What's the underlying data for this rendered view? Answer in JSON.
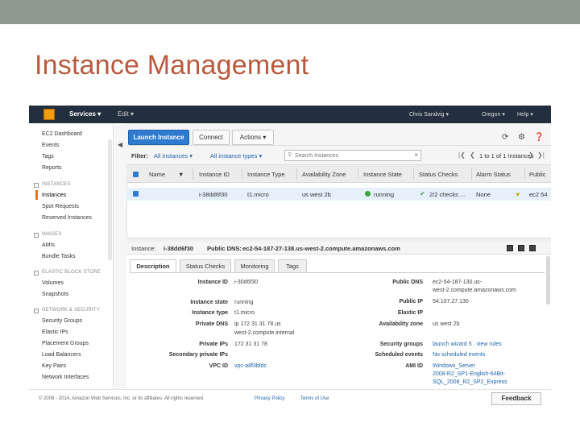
{
  "slide": {
    "title": "Instance Management"
  },
  "header": {
    "services_label": "Services",
    "edit_label": "Edit",
    "user": "Chris Sandvig",
    "region": "Oregon",
    "help": "Help"
  },
  "sidebar": {
    "items": [
      {
        "label": "EC2 Dashboard"
      },
      {
        "label": "Events"
      },
      {
        "label": "Tags"
      },
      {
        "label": "Reports"
      }
    ],
    "instances_head": "INSTANCES",
    "instances_items": [
      {
        "label": "Instances"
      },
      {
        "label": "Spot Requests"
      },
      {
        "label": "Reserved Instances"
      }
    ],
    "images_head": "IMAGES",
    "images_items": [
      {
        "label": "AMIs"
      },
      {
        "label": "Bundle Tasks"
      }
    ],
    "ebs_head": "ELASTIC BLOCK STORE",
    "ebs_items": [
      {
        "label": "Volumes"
      },
      {
        "label": "Snapshots"
      }
    ],
    "net_head": "NETWORK & SECURITY",
    "net_items": [
      {
        "label": "Security Groups"
      },
      {
        "label": "Elastic IPs"
      },
      {
        "label": "Placement Groups"
      },
      {
        "label": "Load Balancers"
      },
      {
        "label": "Key Pairs"
      },
      {
        "label": "Network Interfaces"
      }
    ]
  },
  "toolbar": {
    "launch": "Launch Instance",
    "connect": "Connect",
    "actions": "Actions"
  },
  "filter": {
    "label": "Filter:",
    "instances": "All instances",
    "types": "All instance types",
    "search_placeholder": "Search Instances",
    "paging": "1 to 1 of 1 Instances"
  },
  "table": {
    "columns": [
      "Name",
      "Instance ID",
      "Instance Type",
      "Availability Zone",
      "Instance State",
      "Status Checks",
      "Alarm Status",
      "Public"
    ],
    "rows": [
      {
        "name": "",
        "instance_id": "i-38dd6f30",
        "type": "t1.micro",
        "zone": "us west 2b",
        "state": "running",
        "checks": "2/2 checks ...",
        "alarm": "None",
        "public": "ec2 54"
      }
    ]
  },
  "detail": {
    "instance_label": "Instance:",
    "instance_id": "i-38dd6f30",
    "dns_label": "Public DNS:",
    "dns": "ec2-54-187-27-138.us-west-2.compute.amazonaws.com",
    "tabs": [
      "Description",
      "Status Checks",
      "Monitoring",
      "Tags"
    ],
    "left": [
      {
        "label": "Instance ID",
        "value": "i-30d6f30"
      },
      {
        "label": "Instance state",
        "value": "running"
      },
      {
        "label": "Instance type",
        "value": "t1.micro"
      },
      {
        "label": "Private DNS",
        "value": "ip 172 31 31 78.us",
        "value2": "west-2.compute.internal"
      },
      {
        "label": "Private IPs",
        "value": "172 31 31 78"
      },
      {
        "label": "Secondary private IPs",
        "value": ""
      },
      {
        "label": "VPC ID",
        "value": "vpc-a8f3bfdc"
      }
    ],
    "right": [
      {
        "label": "Public DNS",
        "value": "ec2-54-187-130.us-",
        "value2": "west-2.compute.amazonaws.com"
      },
      {
        "label": "Public IP",
        "value": "54.107.27.130"
      },
      {
        "label": "Elastic IP",
        "value": ""
      },
      {
        "label": "Availability zone",
        "value": "us west 2b"
      },
      {
        "label": "Security groups",
        "value": "launch wizard 5 . view rules"
      },
      {
        "label": "Scheduled events",
        "value": "No scheduled events"
      },
      {
        "label": "AMI ID",
        "value": "Windows_Server",
        "value2": "2008-R2_SP1-English-64Bit-",
        "value3": "SQL_2008_R2_SP2_Express"
      }
    ]
  },
  "footer": {
    "copyright": "© 2008 - 2014, Amazon Web Services, Inc. or its affiliates. All rights reserved.",
    "privacy": "Privacy Policy",
    "terms": "Terms of Use",
    "feedback": "Feedback"
  },
  "colors": {
    "accent": "#2e7bcf",
    "header": "#232f3e",
    "title": "#b85a3e",
    "topbar": "#8d9b8e"
  }
}
